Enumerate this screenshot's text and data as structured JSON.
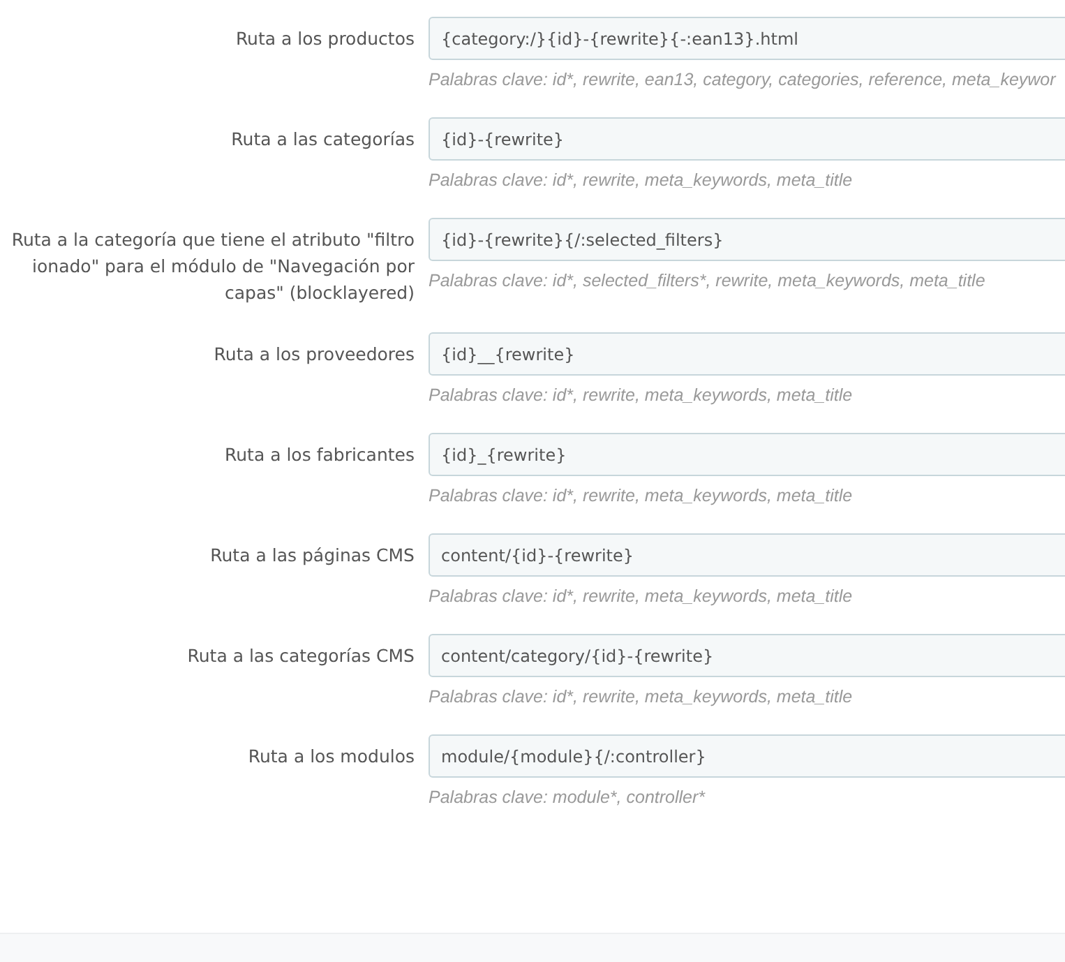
{
  "routes": [
    {
      "label": "Ruta a los productos",
      "value": "{category:/}{id}-{rewrite}{-:ean13}.html",
      "hint": "Palabras clave: id*, rewrite, ean13, category, categories, reference, meta_keywor"
    },
    {
      "label": "Ruta a las categorías",
      "value": "{id}-{rewrite}",
      "hint": "Palabras clave: id*, rewrite, meta_keywords, meta_title"
    },
    {
      "label": "Ruta a la categoría que tiene el atributo \"filtro ionado\" para el módulo de \"Navegación por capas\" (blocklayered)",
      "value": "{id}-{rewrite}{/:selected_filters}",
      "hint": "Palabras clave: id*, selected_filters*, rewrite, meta_keywords, meta_title"
    },
    {
      "label": "Ruta a los proveedores",
      "value": "{id}__{rewrite}",
      "hint": "Palabras clave: id*, rewrite, meta_keywords, meta_title"
    },
    {
      "label": "Ruta a los fabricantes",
      "value": "{id}_{rewrite}",
      "hint": "Palabras clave: id*, rewrite, meta_keywords, meta_title"
    },
    {
      "label": "Ruta a las páginas CMS",
      "value": "content/{id}-{rewrite}",
      "hint": "Palabras clave: id*, rewrite, meta_keywords, meta_title"
    },
    {
      "label": "Ruta a las categorías CMS",
      "value": "content/category/{id}-{rewrite}",
      "hint": "Palabras clave: id*, rewrite, meta_keywords, meta_title"
    },
    {
      "label": "Ruta a los modulos",
      "value": "module/{module}{/:controller}",
      "hint": "Palabras clave: module*, controller*"
    }
  ]
}
